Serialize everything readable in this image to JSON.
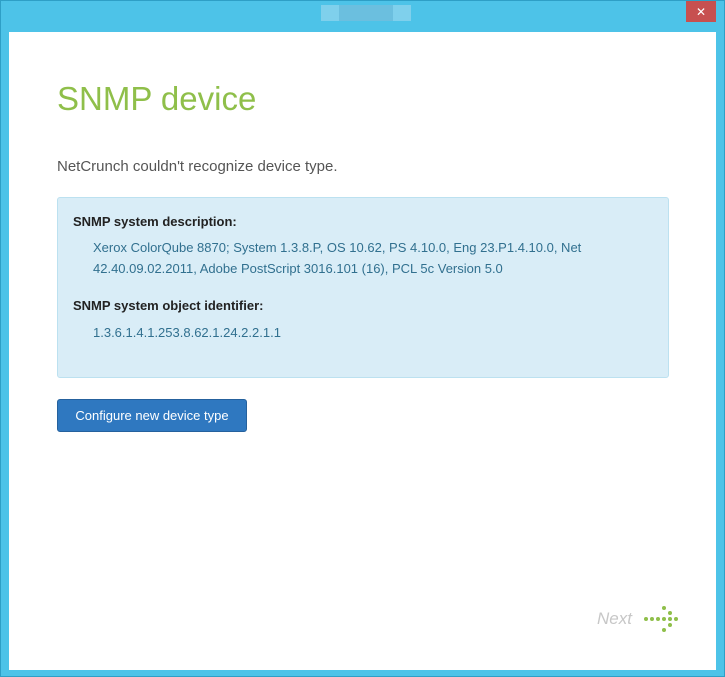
{
  "window": {
    "close_glyph": "✕"
  },
  "page": {
    "title": "SNMP device",
    "subtitle": "NetCrunch couldn't recognize device type."
  },
  "info": {
    "description_label": "SNMP system description:",
    "description_value": "Xerox ColorQube 8870; System 1.3.8.P, OS 10.62, PS 4.10.0, Eng 23.P1.4.10.0, Net 42.40.09.02.2011, Adobe PostScript 3016.101 (16), PCL 5c Version 5.0",
    "oid_label": "SNMP system object identifier:",
    "oid_value": "1.3.6.1.4.1.253.8.62.1.24.2.2.1.1"
  },
  "actions": {
    "configure_label": "Configure new device type",
    "next_label": "Next"
  },
  "colors": {
    "accent_green": "#8fbf4a",
    "button_blue": "#2f78c0",
    "panel_bg": "#d9edf7",
    "window_frame": "#4dc3e8"
  }
}
